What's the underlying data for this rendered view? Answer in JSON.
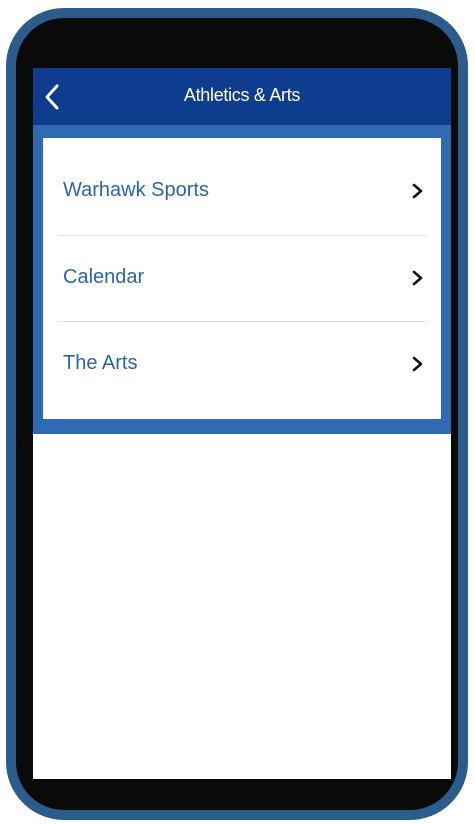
{
  "header": {
    "title": "Athletics & Arts",
    "back_icon": "chevron-left-icon"
  },
  "menu": {
    "items": [
      {
        "label": "Warhawk Sports",
        "icon": "chevron-right-icon"
      },
      {
        "label": "Calendar",
        "icon": "chevron-right-icon"
      },
      {
        "label": "The Arts",
        "icon": "chevron-right-icon"
      }
    ]
  },
  "colors": {
    "device_frame": "#2b5c8c",
    "navbar": "#0e3c8f",
    "menu_band": "#2e6bb3",
    "link_text": "#2a64b0"
  }
}
